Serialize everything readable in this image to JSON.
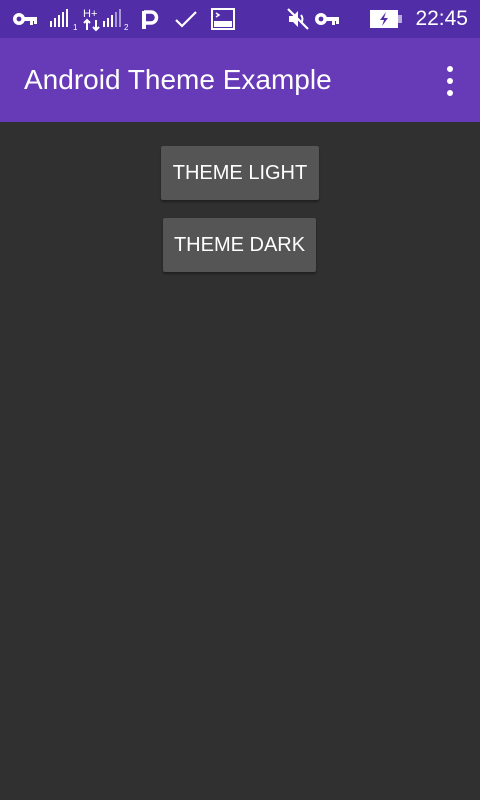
{
  "status_bar": {
    "time": "22:45",
    "icons": [
      "vpn-key-icon",
      "signal-sim1-icon",
      "data-hplus-icon",
      "signal-sim2-icon",
      "p-app-icon",
      "check-icon",
      "screen-icon",
      "mute-icon",
      "vpn-key-icon",
      "battery-charging-icon"
    ],
    "sim1_label": "1",
    "sim2_label": "2",
    "data_label": "H+"
  },
  "app_bar": {
    "title": "Android Theme Example",
    "menu_icon": "overflow-menu-icon"
  },
  "buttons": {
    "theme_light": "THEME LIGHT",
    "theme_dark": "THEME DARK"
  },
  "colors": {
    "status_bar": "#512DA8",
    "app_bar": "#673AB7",
    "background": "#303030",
    "button": "#555555",
    "text": "#FFFFFF"
  }
}
